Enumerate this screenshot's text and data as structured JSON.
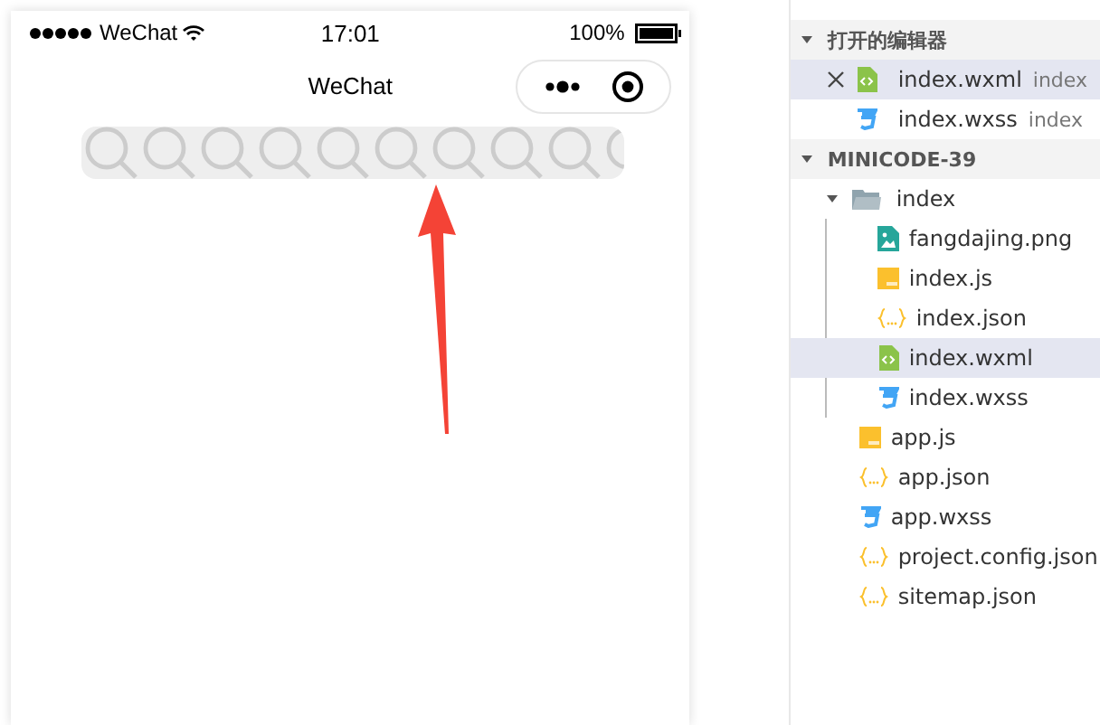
{
  "phone": {
    "status_bar": {
      "carrier": "WeChat",
      "time": "17:01",
      "battery": "100%"
    },
    "nav_title": "WeChat"
  },
  "explorer": {
    "sections": [
      {
        "title": "打开的编辑器",
        "expanded": true,
        "items": [
          {
            "name": "index.wxml",
            "hint": "index",
            "kind": "wxml",
            "selected": true
          },
          {
            "name": "index.wxss",
            "hint": "index",
            "kind": "wxss",
            "selected": false
          }
        ]
      },
      {
        "title": "MINICODE-39",
        "expanded": true,
        "items": [
          {
            "name": "index",
            "kind": "folder",
            "expanded": true,
            "selected": false,
            "children": [
              {
                "name": "fangdajing.png",
                "kind": "png",
                "selected": false
              },
              {
                "name": "index.js",
                "kind": "js",
                "selected": false
              },
              {
                "name": "index.json",
                "kind": "json",
                "selected": false
              },
              {
                "name": "index.wxml",
                "kind": "wxml",
                "selected": true
              },
              {
                "name": "index.wxss",
                "kind": "wxss",
                "selected": false
              }
            ]
          },
          {
            "name": "app.js",
            "kind": "js",
            "selected": false
          },
          {
            "name": "app.json",
            "kind": "json",
            "selected": false
          },
          {
            "name": "app.wxss",
            "kind": "wxss",
            "selected": false
          },
          {
            "name": "project.config.json",
            "kind": "json",
            "selected": false
          },
          {
            "name": "sitemap.json",
            "kind": "json",
            "selected": false
          }
        ]
      }
    ]
  }
}
